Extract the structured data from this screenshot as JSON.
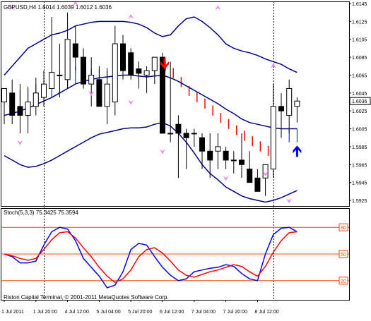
{
  "colors": {
    "background": "#ffffff",
    "frame": "#000000",
    "grid": "#000000",
    "bollinger": "#00008b",
    "ma_fill": "#0000ff",
    "trend_down": "#ff0000",
    "up_arrow": "#0000ff",
    "down_arrow": "#ff0000",
    "fractal": "#ee82ee",
    "stoch_main": "#0000ff",
    "stoch_signal": "#ff0000",
    "stoch_level": "#ff4500",
    "current_price_bg": "#ffffff"
  },
  "header": {
    "symbol_info": "GBPUSD,H4 1.6014 1.6039 1.6012 1.6036"
  },
  "footer": {
    "copyright": "Riston Capital Terminal, © 2001-2011 MetaQuotes Software Corp."
  },
  "chart_data": [
    {
      "type": "candlestick",
      "title": "GBPUSD,H4 1.6014 1.6039 1.6012 1.6036",
      "xlabel": "",
      "ylabel": "",
      "ylim": [
        1.5925,
        1.6145
      ],
      "ytick_labels": [
        "1.6145",
        "1.6125",
        "1.6105",
        "1.6085",
        "1.6065",
        "1.6045",
        "1.6025",
        "1.6005",
        "1.5985",
        "1.5965",
        "1.5945",
        "1.5925"
      ],
      "ytick_values": [
        1.6145,
        1.6125,
        1.6105,
        1.6085,
        1.6065,
        1.6045,
        1.6025,
        1.6005,
        1.5985,
        1.5965,
        1.5945,
        1.5925
      ],
      "current_price": 1.6036,
      "current_price_label": "1.6036",
      "x_labels": [
        "1 Jul 2011",
        "1 Jul 20:00",
        "4 Jul 12:00",
        "5 Jul 04:00",
        "5 Jul 20:00",
        "6 Jul 12:00",
        "7 Jul 04:00",
        "7 Jul 20:00",
        "8 Jul 12:00"
      ],
      "x_label_bars": [
        0,
        4,
        8,
        12,
        16,
        20,
        24,
        28,
        32
      ],
      "separator_bars": [
        5,
        34
      ],
      "candles": {
        "open": [
          1.6035,
          1.6045,
          1.603,
          1.602,
          1.603,
          1.604,
          1.605,
          1.6065,
          1.606,
          1.61,
          1.6085,
          1.6055,
          1.606,
          1.603,
          1.6035,
          1.61,
          1.609,
          1.6072,
          1.6065,
          1.607,
          1.6085,
          1.6,
          1.601,
          1.6,
          1.6,
          1.5995,
          1.598,
          1.598,
          1.598,
          1.597,
          1.597,
          1.596,
          1.595,
          1.595,
          1.596,
          1.603,
          1.602,
          1.603
        ],
        "high": [
          1.605,
          1.606,
          1.6055,
          1.605,
          1.6062,
          1.607,
          1.613,
          1.61,
          1.6135,
          1.612,
          1.6095,
          1.6085,
          1.6075,
          1.607,
          1.612,
          1.611,
          1.6095,
          1.608,
          1.6075,
          1.6085,
          1.609,
          1.608,
          1.602,
          1.6005,
          1.6005,
          1.6,
          1.6,
          1.6,
          1.5985,
          1.598,
          1.6,
          1.598,
          1.596,
          1.5955,
          1.6055,
          1.6045,
          1.606,
          1.604
        ],
        "low": [
          1.601,
          1.601,
          1.6,
          1.6,
          1.602,
          1.603,
          1.605,
          1.604,
          1.605,
          1.607,
          1.605,
          1.603,
          1.603,
          1.601,
          1.602,
          1.606,
          1.606,
          1.605,
          1.6045,
          1.6055,
          1.6,
          1.599,
          1.595,
          1.596,
          1.5985,
          1.596,
          1.595,
          1.596,
          1.596,
          1.5955,
          1.595,
          1.5945,
          1.5935,
          1.593,
          1.595,
          1.5995,
          1.6,
          1.6012
        ],
        "close": [
          1.605,
          1.602,
          1.602,
          1.6035,
          1.6045,
          1.6055,
          1.6068,
          1.6065,
          1.6105,
          1.6085,
          1.6055,
          1.6065,
          1.603,
          1.6055,
          1.61,
          1.607,
          1.6065,
          1.6067,
          1.607,
          1.6085,
          1.6,
          1.6,
          1.6,
          1.5995,
          1.6,
          1.598,
          1.597,
          1.5985,
          1.597,
          1.597,
          1.5965,
          1.5945,
          1.5935,
          1.5965,
          1.603,
          1.6025,
          1.605,
          1.6036
        ]
      },
      "series": [
        {
          "name": "",
          "style": "line",
          "values": [
            1.6065,
            1.6075,
            1.6085,
            1.6095,
            1.61,
            1.6105,
            1.611,
            1.6112,
            1.6115,
            1.612,
            1.6122,
            1.6124,
            1.6125,
            1.6125,
            1.6125,
            1.6125,
            1.6124,
            1.6122,
            1.6118,
            1.6112,
            1.6108,
            1.611,
            1.612,
            1.6128,
            1.613,
            1.6125,
            1.6118,
            1.611,
            1.61,
            1.6095,
            1.6092,
            1.609,
            1.6087,
            1.6083,
            1.608,
            1.6077,
            1.6072,
            1.6068
          ]
        },
        {
          "name": "",
          "style": "line",
          "values": [
            1.602,
            1.6022,
            1.6025,
            1.6028,
            1.6032,
            1.6036,
            1.604,
            1.6045,
            1.605,
            1.6055,
            1.6058,
            1.606,
            1.6062,
            1.6063,
            1.6064,
            1.6065,
            1.6065,
            1.6064,
            1.6063,
            1.6064,
            1.6065,
            1.6062,
            1.6058,
            1.6053,
            1.6048,
            1.6043,
            1.6038,
            1.6033,
            1.6027,
            1.6022,
            1.6016,
            1.6012,
            1.601,
            1.6008,
            1.6006,
            1.6005,
            1.6005,
            1.6005
          ]
        },
        {
          "name": "",
          "style": "line",
          "values": [
            1.5975,
            1.597,
            1.5965,
            1.5962,
            1.5963,
            1.5966,
            1.597,
            1.5975,
            1.598,
            1.5985,
            1.599,
            1.5995,
            1.5999,
            1.6001,
            1.6003,
            1.6005,
            1.6006,
            1.6006,
            1.6007,
            1.601,
            1.6012,
            1.6008,
            1.6,
            1.599,
            1.5978,
            1.5965,
            1.5955,
            1.5948,
            1.594,
            1.5935,
            1.593,
            1.5927,
            1.5925,
            1.5923,
            1.5925,
            1.5928,
            1.5932,
            1.5936
          ]
        },
        {
          "name": "",
          "style": "fill_to_mid",
          "values": [
            1.6042,
            1.6045,
            1.6048,
            1.6052,
            1.6055,
            1.606,
            1.6065,
            1.607,
            1.6073,
            1.6075,
            1.6074,
            1.6072,
            1.6072,
            1.6073,
            1.6075,
            1.6075,
            1.6073,
            1.6072,
            1.607,
            1.6072,
            1.6075,
            null,
            null,
            null,
            null,
            null,
            null,
            null,
            null,
            null,
            null,
            null,
            null,
            null,
            1.6002,
            1.5995,
            1.599,
            1.599
          ]
        },
        {
          "name": "",
          "style": "trend_down",
          "values": [
            null,
            null,
            null,
            null,
            null,
            null,
            null,
            null,
            null,
            null,
            null,
            null,
            null,
            null,
            null,
            null,
            null,
            null,
            null,
            null,
            1.608,
            1.6072,
            1.6062,
            1.6052,
            1.6045,
            1.6038,
            1.603,
            1.6022,
            1.6015,
            1.6008,
            1.6002,
            1.5996,
            1.599,
            1.5985,
            null,
            null,
            null,
            null
          ]
        }
      ],
      "markers": {
        "fractals_up": [
          [
            1,
            1.614
          ],
          [
            9,
            1.6145
          ],
          [
            16,
            1.613
          ],
          [
            27,
            1.614
          ],
          [
            34,
            1.6075
          ]
        ],
        "fractals_down": [
          [
            2,
            1.599
          ],
          [
            11,
            1.6045
          ],
          [
            16,
            1.6035
          ],
          [
            20,
            1.598
          ],
          [
            28,
            1.595
          ],
          [
            33,
            1.5955
          ],
          [
            36,
            1.5925
          ]
        ],
        "arrow_down": [
          [
            20,
            1.6078
          ]
        ],
        "arrow_up": [
          [
            37,
            1.598
          ]
        ]
      },
      "grid": false,
      "legend": "none"
    },
    {
      "type": "line",
      "title": "Stoch(5,3,3) 75.3425 75.3594",
      "xlabel": "",
      "ylabel": "",
      "ylim": [
        0,
        100
      ],
      "levels": [
        80,
        50,
        20
      ],
      "level_labels": [
        "80",
        "50",
        "20"
      ],
      "series": [
        {
          "name": "",
          "color": "stoch_main",
          "values": [
            50,
            47,
            40,
            40,
            42,
            60,
            75,
            80,
            78,
            65,
            45,
            35,
            25,
            12,
            15,
            30,
            55,
            62,
            60,
            47,
            35,
            26,
            20,
            22,
            30,
            32,
            34,
            35,
            38,
            36,
            28,
            22,
            20,
            50,
            72,
            79,
            80,
            75
          ]
        },
        {
          "name": "",
          "color": "stoch_signal",
          "values": [
            50,
            48,
            45,
            43,
            45,
            55,
            66,
            74,
            75,
            68,
            57,
            47,
            35,
            25,
            18,
            22,
            32,
            47,
            55,
            57,
            51,
            42,
            32,
            26,
            24,
            27,
            30,
            32,
            35,
            38,
            36,
            30,
            25,
            36,
            52,
            65,
            74,
            75
          ]
        }
      ],
      "grid": false,
      "legend": "none"
    }
  ]
}
